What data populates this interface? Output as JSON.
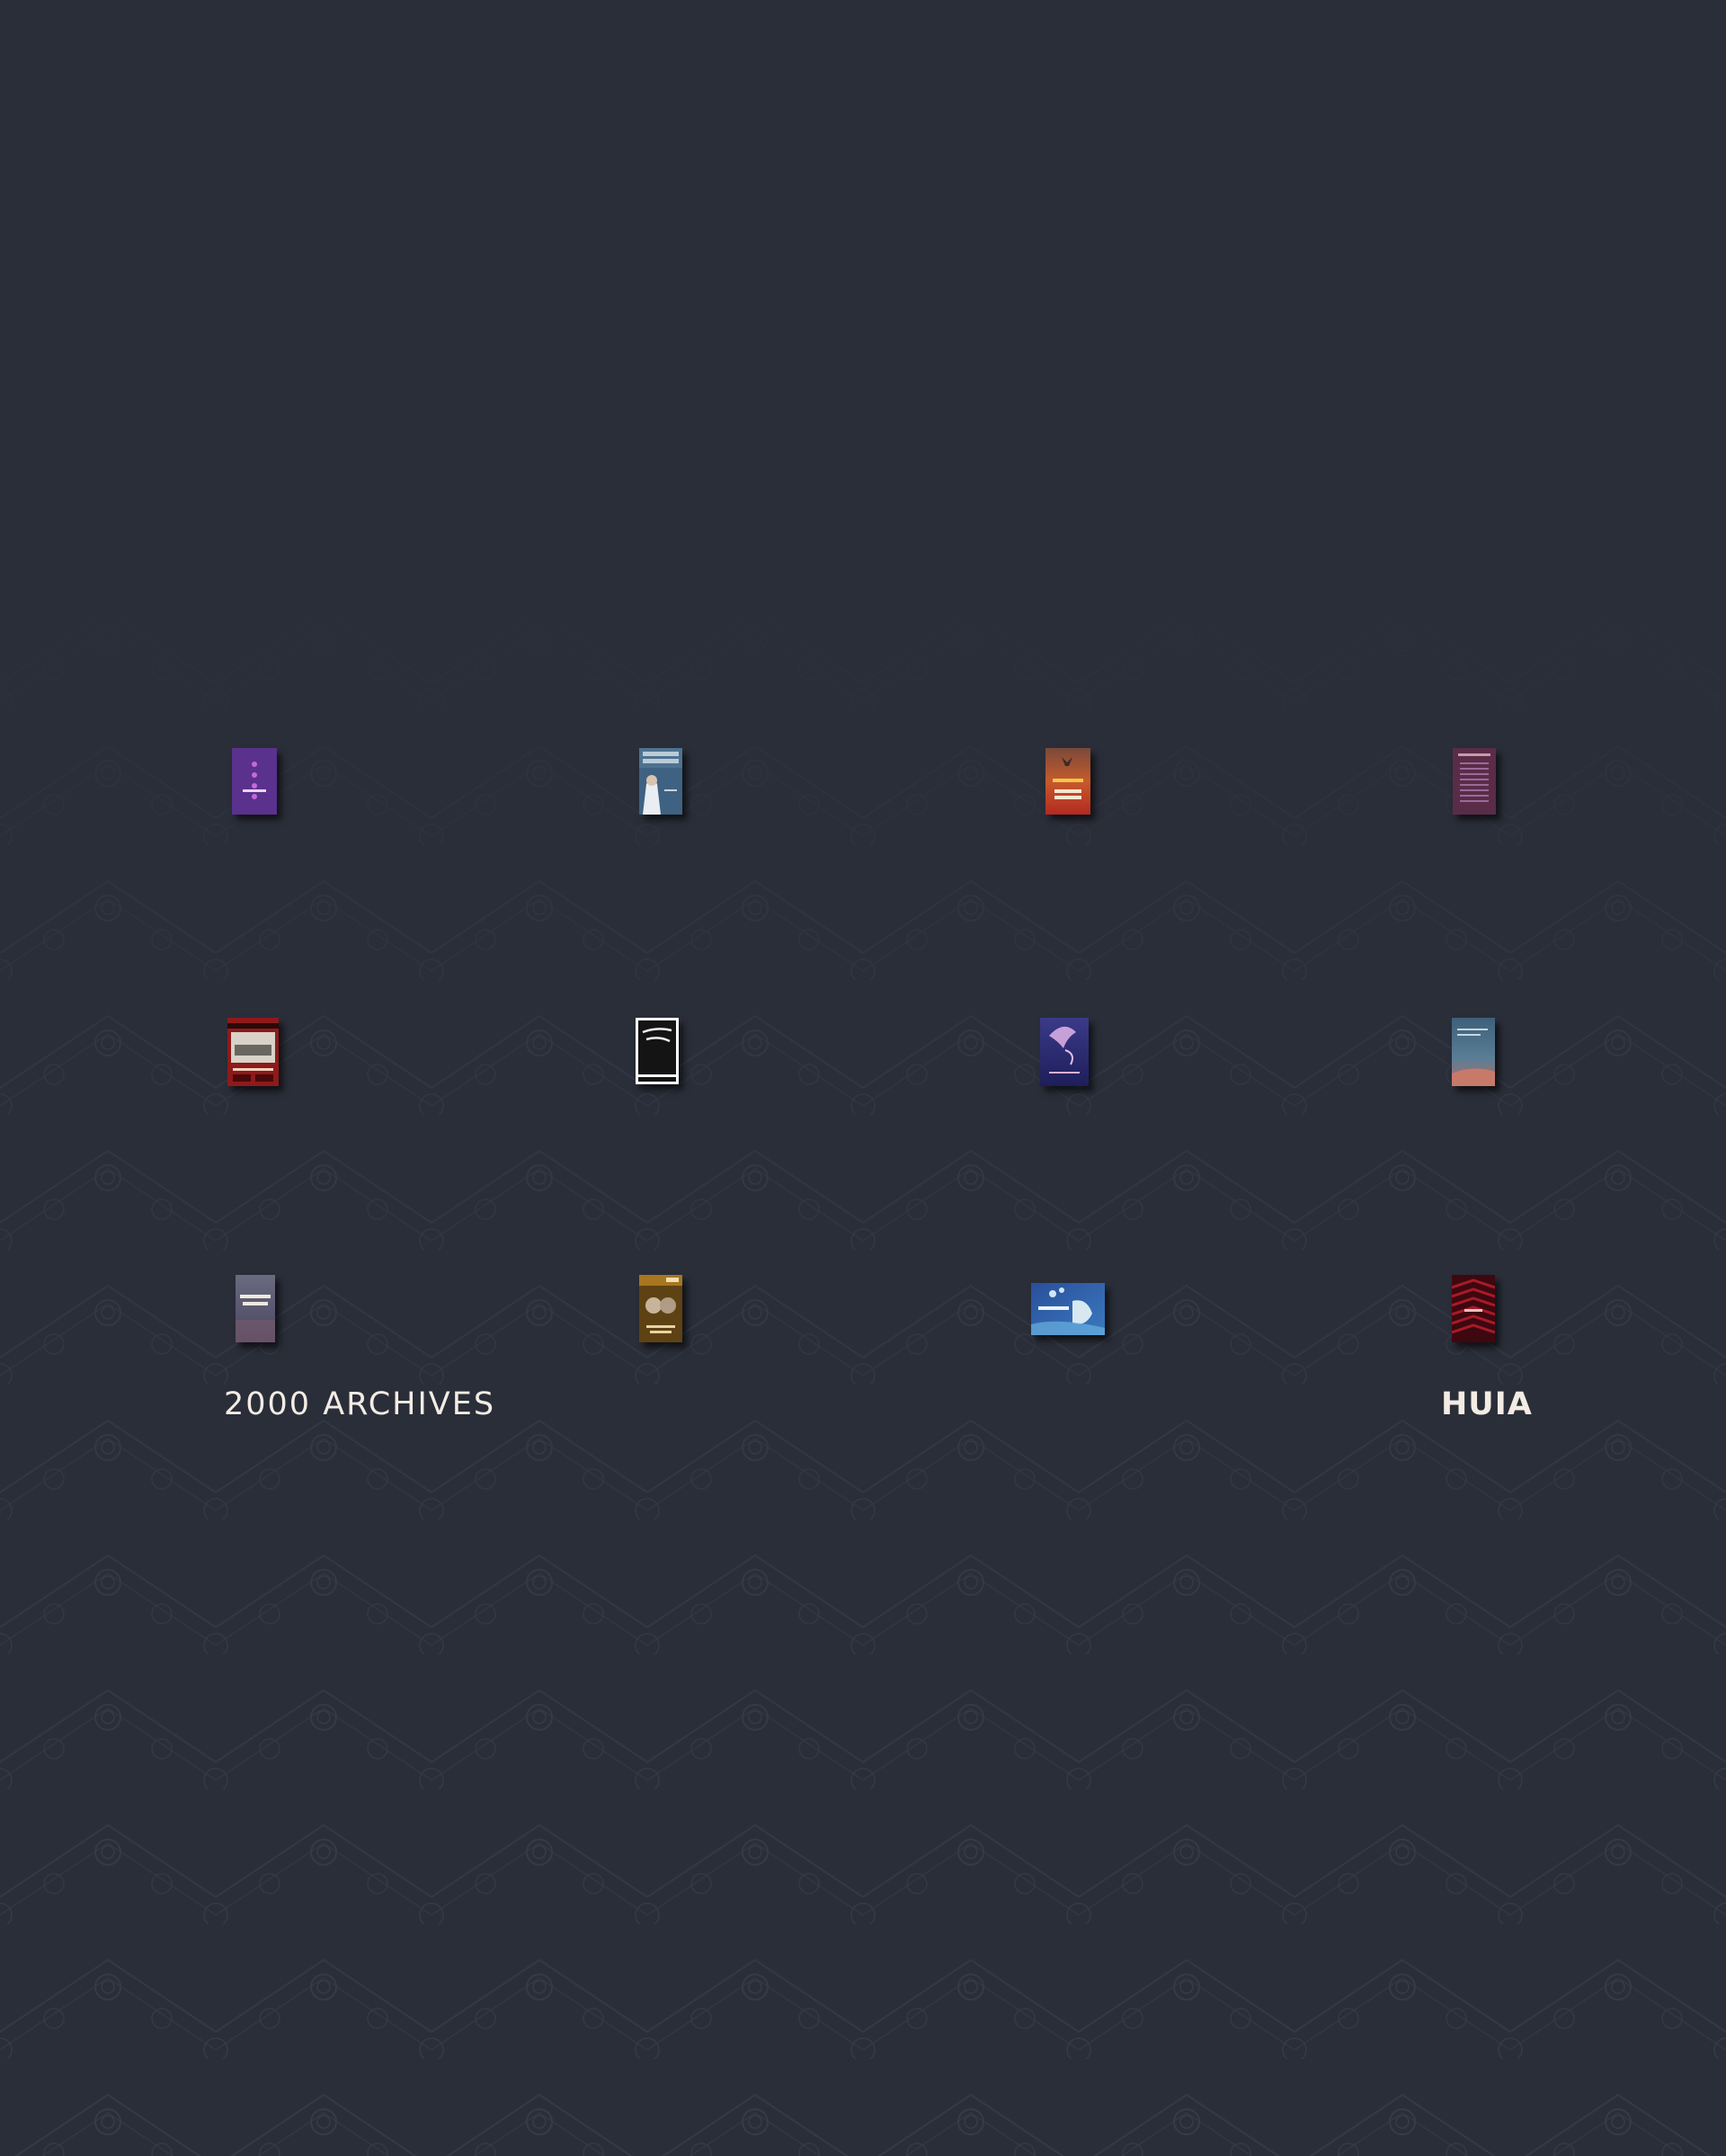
{
  "archive_label": "2000 ARCHIVES",
  "publisher_label": "HUIA",
  "books": [
    {
      "cover_text": "",
      "colors": [
        "#4a2a7a",
        "#7a3fa8"
      ]
    },
    {
      "cover_text": "GRAHAM LATIMER",
      "colors": [
        "#3d5f7e",
        "#9fb6c6"
      ]
    },
    {
      "cover_text": "ST VILA ALBERT WENDT",
      "colors": [
        "#b4542e",
        "#d07a3e"
      ]
    },
    {
      "cover_text": "",
      "colors": [
        "#5a2a44",
        "#8a3a5a"
      ]
    },
    {
      "cover_text": "",
      "colors": [
        "#8a1a1a",
        "#d8d4cc"
      ]
    },
    {
      "cover_text": "CULTURE SPEAKS",
      "colors": [
        "#ffffff",
        "#111111"
      ]
    },
    {
      "cover_text": "",
      "colors": [
        "#2a2a6e",
        "#b07ab6"
      ]
    },
    {
      "cover_text": "",
      "colors": [
        "#4a6d86",
        "#b86a5a"
      ]
    },
    {
      "cover_text": "Skeleton Woman",
      "colors": [
        "#5f5c72",
        "#9a8ea0"
      ]
    },
    {
      "cover_text": "The Songmaker's Chair",
      "colors": [
        "#6a4a1a",
        "#c49a3a"
      ]
    },
    {
      "cover_text": "",
      "colors": [
        "#2f5ca8",
        "#8fc0e8"
      ]
    },
    {
      "cover_text": "",
      "colors": [
        "#4a0a12",
        "#b01e2c"
      ]
    }
  ]
}
